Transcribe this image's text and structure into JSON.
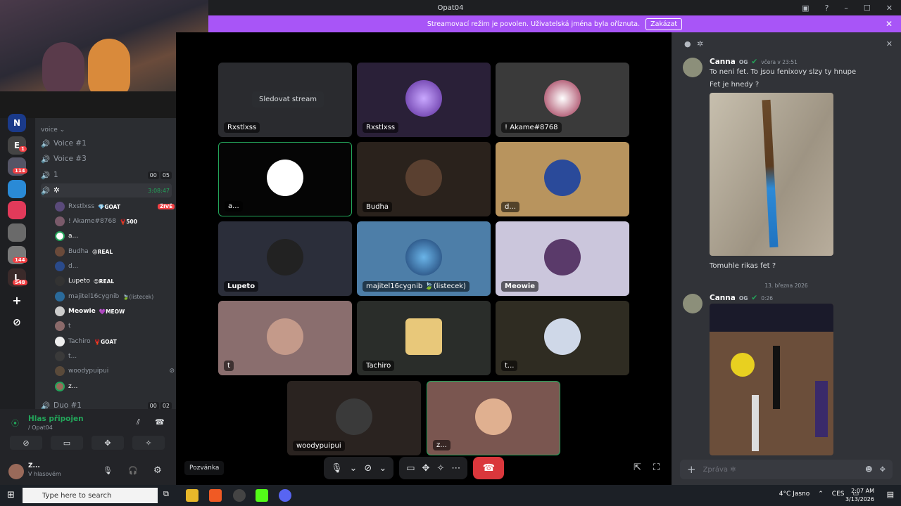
{
  "window": {
    "title": "Opat04"
  },
  "banner": {
    "text": "Streamovací režim je povolen. Uživatelská jména byla oříznuta.",
    "button": "Zakázat"
  },
  "channels": {
    "category": "voice ⌄",
    "items": [
      {
        "name": "Voice #1"
      },
      {
        "name": "Voice #3"
      },
      {
        "name": "1",
        "counts": [
          "00",
          "05"
        ]
      },
      {
        "name": "✲",
        "time": "3:08:47"
      },
      {
        "name": "Duo #1",
        "counts": [
          "00",
          "02"
        ]
      }
    ],
    "members": [
      {
        "name": "Rxstlxss",
        "tag": "💎GOAT",
        "live": "ŽIVĚ"
      },
      {
        "name": "! Akame#8768",
        "tag": "🦞500"
      },
      {
        "name": "a..."
      },
      {
        "name": "Budha",
        "tag": "😡REAL"
      },
      {
        "name": "d..."
      },
      {
        "name": "Lupeto",
        "tag": "😡REAL"
      },
      {
        "name": "majitel16cygnib",
        "tag": "🍃(listecek)"
      },
      {
        "name": "Meowie",
        "tag": "💜MEOW"
      },
      {
        "name": "t"
      },
      {
        "name": "Tachiro",
        "tag": "🦞GOAT"
      },
      {
        "name": "t..."
      },
      {
        "name": "woodypuipui"
      },
      {
        "name": "z..."
      }
    ]
  },
  "servers": {
    "badges": [
      "1",
      "114",
      "144",
      "548"
    ],
    "top_letter": "N"
  },
  "voice": {
    "status": "Hlas připojen",
    "channel": "/ Opat04"
  },
  "user": {
    "name": "Z...",
    "status": "V hlasovém"
  },
  "stage": {
    "tooltip": "Sledovat stream",
    "tiles": [
      {
        "label": "Rxstlxss"
      },
      {
        "label": "Rxstlxss"
      },
      {
        "label": "! Akame#8768"
      },
      {
        "label": "a..."
      },
      {
        "label": "Budha"
      },
      {
        "label": "d..."
      },
      {
        "label": "Lupeto"
      },
      {
        "label": "majitel16cygnib 🍃(listecek)"
      },
      {
        "label": "Meowie"
      },
      {
        "label": "t"
      },
      {
        "label": "Tachiro"
      },
      {
        "label": "t..."
      },
      {
        "label": "woodypuipui"
      },
      {
        "label": "z..."
      }
    ],
    "invite": "Pozvánka"
  },
  "chat": {
    "msg1": {
      "author": "Canna",
      "badge": "OG",
      "time": "včera v 23:51",
      "lines": [
        "To neni fet. To jsou fenixovy slzy ty hnupe",
        "Fet je hnedy ?"
      ],
      "after": "Tomuhle rikas fet ?"
    },
    "divider": "13. března 2026",
    "msg2": {
      "author": "Canna",
      "badge": "OG",
      "time": "0:26"
    },
    "input_placeholder": "Zpráva ✲"
  },
  "taskbar": {
    "search": "Type here to search",
    "weather": "4°C  Jasno",
    "lang": "CES",
    "time": "2:07 AM",
    "date": "3/13/2026"
  }
}
